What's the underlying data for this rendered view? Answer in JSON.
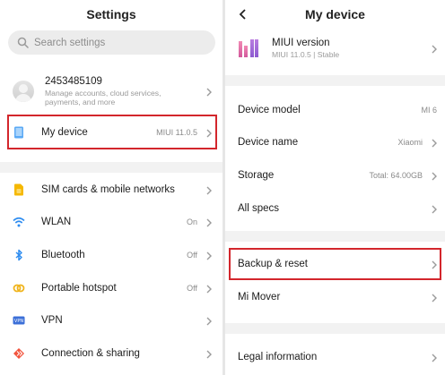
{
  "left": {
    "title": "Settings",
    "search_placeholder": "Search settings",
    "account": {
      "id": "2453485109",
      "subtitle": "Manage accounts, cloud services, payments, and more"
    },
    "my_device": {
      "label": "My device",
      "value": "MIUI 11.0.5"
    },
    "items": [
      {
        "label": "SIM cards & mobile networks",
        "value": "",
        "icon": "sim-icon"
      },
      {
        "label": "WLAN",
        "value": "On",
        "icon": "wifi-icon"
      },
      {
        "label": "Bluetooth",
        "value": "Off",
        "icon": "bluetooth-icon"
      },
      {
        "label": "Portable hotspot",
        "value": "Off",
        "icon": "hotspot-icon"
      },
      {
        "label": "VPN",
        "value": "",
        "icon": "vpn-icon"
      },
      {
        "label": "Connection & sharing",
        "value": "",
        "icon": "share-icon"
      }
    ]
  },
  "right": {
    "title": "My device",
    "miui": {
      "title": "MIUI version",
      "subtitle": "MIUI 11.0.5 | Stable"
    },
    "items": [
      {
        "label": "Device model",
        "value": "MI 6"
      },
      {
        "label": "Device name",
        "value": "Xiaomi"
      },
      {
        "label": "Storage",
        "value": "Total: 64.00GB"
      },
      {
        "label": "All specs",
        "value": ""
      },
      {
        "label": "Backup & reset",
        "value": ""
      },
      {
        "label": "Mi Mover",
        "value": ""
      },
      {
        "label": "Legal information",
        "value": ""
      }
    ]
  },
  "colors": {
    "highlight": "#d3262c",
    "accent_blue": "#2d8cf0",
    "sim_yellow": "#f5b800",
    "hotspot_yellow": "#f0b41c",
    "vpn_blue": "#3b6fd8",
    "share_red": "#f2543d"
  }
}
